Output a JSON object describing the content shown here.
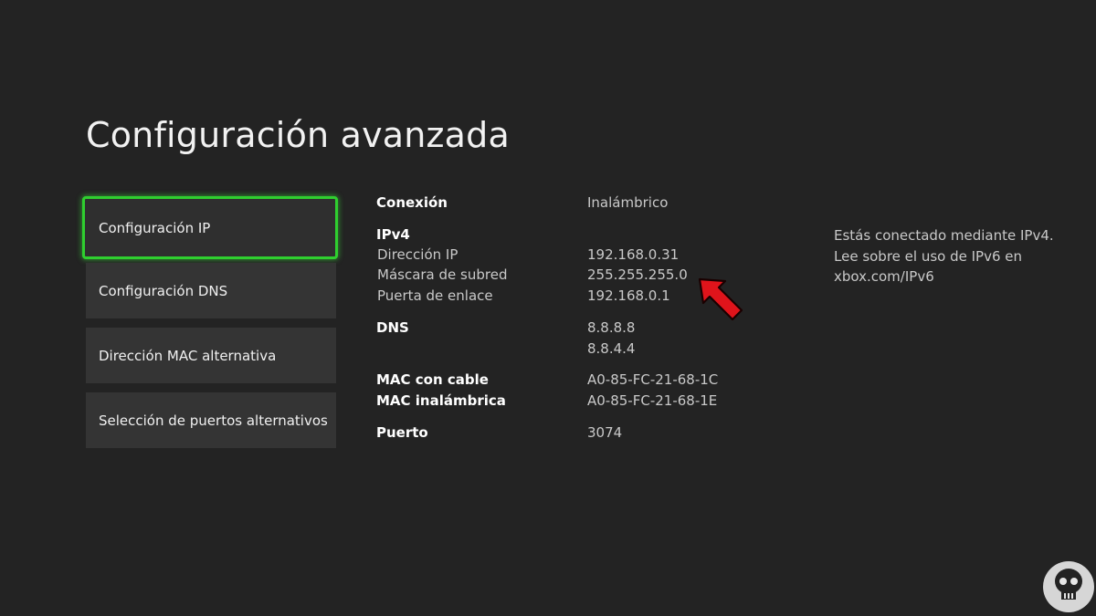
{
  "page": {
    "title": "Configuración avanzada"
  },
  "menu": {
    "items": [
      {
        "label": "Configuración IP",
        "selected": true
      },
      {
        "label": "Configuración DNS",
        "selected": false
      },
      {
        "label": "Dirección MAC alternativa",
        "selected": false
      },
      {
        "label": "Selección de puertos alternativos",
        "selected": false
      }
    ]
  },
  "details": {
    "connection": {
      "label": "Conexión",
      "value": "Inalámbrico"
    },
    "ipv4": {
      "heading": "IPv4",
      "ip_address": {
        "label": "Dirección IP",
        "value": "192.168.0.31"
      },
      "subnet_mask": {
        "label": "Máscara de subred",
        "value": "255.255.255.0"
      },
      "gateway": {
        "label": "Puerta de enlace",
        "value": "192.168.0.1"
      }
    },
    "dns": {
      "label": "DNS",
      "primary": "8.8.8.8",
      "secondary": "8.8.4.4"
    },
    "wired_mac": {
      "label": "MAC con cable",
      "value": "A0-85-FC-21-68-1C"
    },
    "wireless_mac": {
      "label": "MAC inalámbrica",
      "value": "A0-85-FC-21-68-1E"
    },
    "port": {
      "label": "Puerto",
      "value": "3074"
    }
  },
  "side_note": {
    "line1": "Estás conectado mediante IPv4.",
    "line2": "Lee sobre el uso de IPv6 en",
    "line3": "xbox.com/IPv6"
  },
  "annotations": {
    "arrow_icon": "red-arrow-icon",
    "arrow_color": "#e0141b"
  },
  "watermark": {
    "icon": "skull-logo-icon",
    "color": "#e6e6e6"
  },
  "colors": {
    "background": "#232323",
    "focus_green": "#2fcf2f",
    "tile": "#343434"
  }
}
